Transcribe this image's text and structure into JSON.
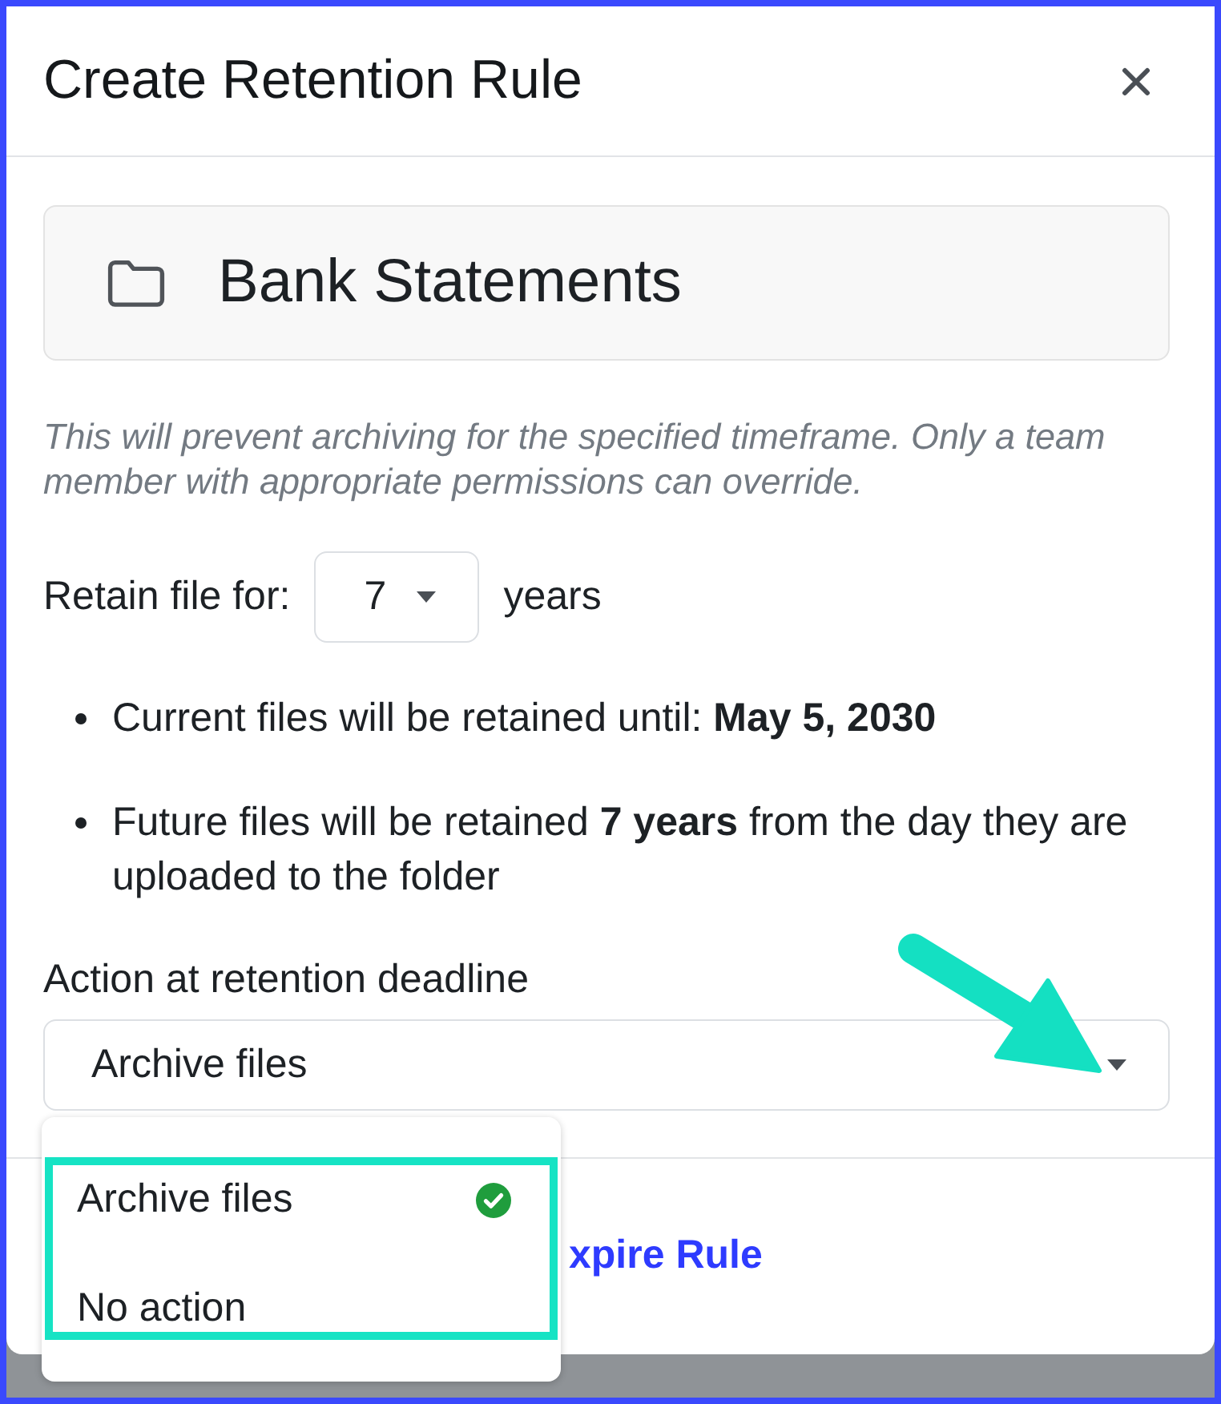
{
  "dialog": {
    "title": "Create Retention Rule"
  },
  "folder": {
    "name": "Bank Statements"
  },
  "notice": "This will prevent archiving for the specified timeframe. Only a team member with appropriate permissions can override.",
  "retention": {
    "label": "Retain file for:",
    "value": "7",
    "unit": "years"
  },
  "details": [
    "Current files will be retained until: **May 5, 2030**",
    "Future files will be retained **7 years** from the day they are uploaded to the folder"
  ],
  "action": {
    "label": "Action at retention deadline",
    "value": "Archive files",
    "expanded": true,
    "options": [
      {
        "label": "Archive files",
        "selected": true
      },
      {
        "label": "No action",
        "selected": false
      }
    ]
  },
  "footer": {
    "link": "xpire Rule"
  },
  "annotations": {
    "arrow": true,
    "highlight": true
  }
}
